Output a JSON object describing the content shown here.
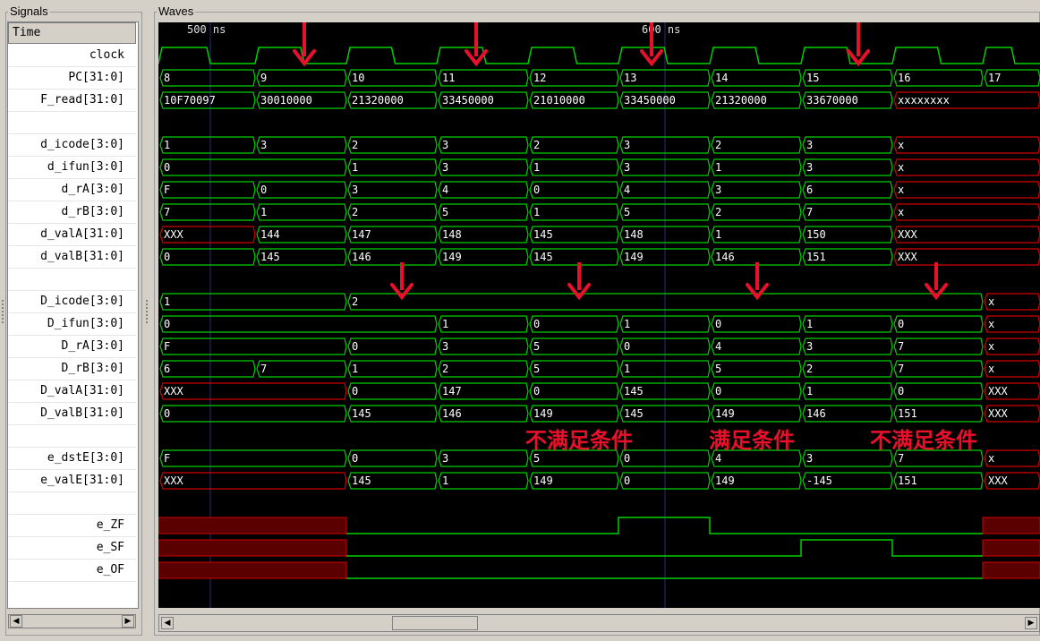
{
  "panels": {
    "signals_title": "Signals",
    "waves_title": "Waves"
  },
  "time": {
    "header": "Time",
    "marker_left": "500 ns",
    "marker_right": "600 ns"
  },
  "colors": {
    "wave": "#00d000",
    "undefined": "#d00000",
    "undefined_fill": "#5a0000",
    "background": "#000000",
    "annotation": "#e8102a",
    "grid": "#2b2b7a"
  },
  "signals": [
    {
      "name": "clock",
      "kind": "clock"
    },
    {
      "name": "PC[31:0]",
      "kind": "bus",
      "values": [
        "8",
        "9",
        "10",
        "11",
        "12",
        "13",
        "14",
        "15",
        "16",
        "17"
      ]
    },
    {
      "name": "F_read[31:0]",
      "kind": "bus",
      "values": [
        "10F70097",
        "30010000",
        "21320000",
        "33450000",
        "21010000",
        "33450000",
        "21320000",
        "33670000",
        "xxxxxxxx"
      ]
    },
    {
      "name": "",
      "kind": "blank"
    },
    {
      "name": "d_icode[3:0]",
      "kind": "bus",
      "values": [
        "1",
        "3",
        "2",
        "3",
        "2",
        "3",
        "2",
        "3",
        "x"
      ]
    },
    {
      "name": "d_ifun[3:0]",
      "kind": "bus",
      "values": [
        "0",
        "1",
        "3",
        "1",
        "3",
        "1",
        "3",
        "x"
      ]
    },
    {
      "name": "d_rA[3:0]",
      "kind": "bus",
      "values": [
        "F",
        "0",
        "3",
        "4",
        "0",
        "4",
        "3",
        "6",
        "x"
      ]
    },
    {
      "name": "d_rB[3:0]",
      "kind": "bus",
      "values": [
        "7",
        "1",
        "2",
        "5",
        "1",
        "5",
        "2",
        "7",
        "x"
      ]
    },
    {
      "name": "d_valA[31:0]",
      "kind": "bus",
      "values": [
        "XXX",
        "144",
        "147",
        "148",
        "145",
        "148",
        "1",
        "150",
        "XXX"
      ]
    },
    {
      "name": "d_valB[31:0]",
      "kind": "bus",
      "values": [
        "0",
        "145",
        "146",
        "149",
        "145",
        "149",
        "146",
        "151",
        "XXX"
      ]
    },
    {
      "name": "",
      "kind": "blank"
    },
    {
      "name": "D_icode[3:0]",
      "kind": "bus",
      "values": [
        "1",
        "2",
        "x"
      ]
    },
    {
      "name": "D_ifun[3:0]",
      "kind": "bus",
      "values": [
        "0",
        "1",
        "0",
        "1",
        "0",
        "1",
        "0",
        "x"
      ]
    },
    {
      "name": "D_rA[3:0]",
      "kind": "bus",
      "values": [
        "F",
        "0",
        "3",
        "5",
        "0",
        "4",
        "3",
        "7",
        "x"
      ]
    },
    {
      "name": "D_rB[3:0]",
      "kind": "bus",
      "values": [
        "6",
        "7",
        "1",
        "2",
        "5",
        "1",
        "5",
        "2",
        "7",
        "x"
      ]
    },
    {
      "name": "D_valA[31:0]",
      "kind": "bus",
      "values": [
        "XXX",
        "0",
        "147",
        "0",
        "145",
        "0",
        "1",
        "0",
        "XXX"
      ]
    },
    {
      "name": "D_valB[31:0]",
      "kind": "bus",
      "values": [
        "0",
        "145",
        "146",
        "149",
        "145",
        "149",
        "146",
        "151",
        "XXX"
      ]
    },
    {
      "name": "",
      "kind": "blank"
    },
    {
      "name": "e_dstE[3:0]",
      "kind": "bus",
      "values": [
        "F",
        "0",
        "3",
        "5",
        "0",
        "4",
        "3",
        "7",
        "x"
      ]
    },
    {
      "name": "e_valE[31:0]",
      "kind": "bus",
      "values": [
        "XXX",
        "145",
        "1",
        "149",
        "0",
        "149",
        "-145",
        "151",
        "XXX"
      ]
    },
    {
      "name": "",
      "kind": "blank"
    },
    {
      "name": "e_ZF",
      "kind": "bit"
    },
    {
      "name": "e_SF",
      "kind": "bit"
    },
    {
      "name": "e_OF",
      "kind": "bit"
    }
  ],
  "annotations": {
    "not_satisfied_1": "不满足条件",
    "satisfied": "满足条件",
    "not_satisfied_2": "不满足条件"
  },
  "scrollbars": {
    "left_arrow": "◀",
    "right_arrow": "▶"
  }
}
